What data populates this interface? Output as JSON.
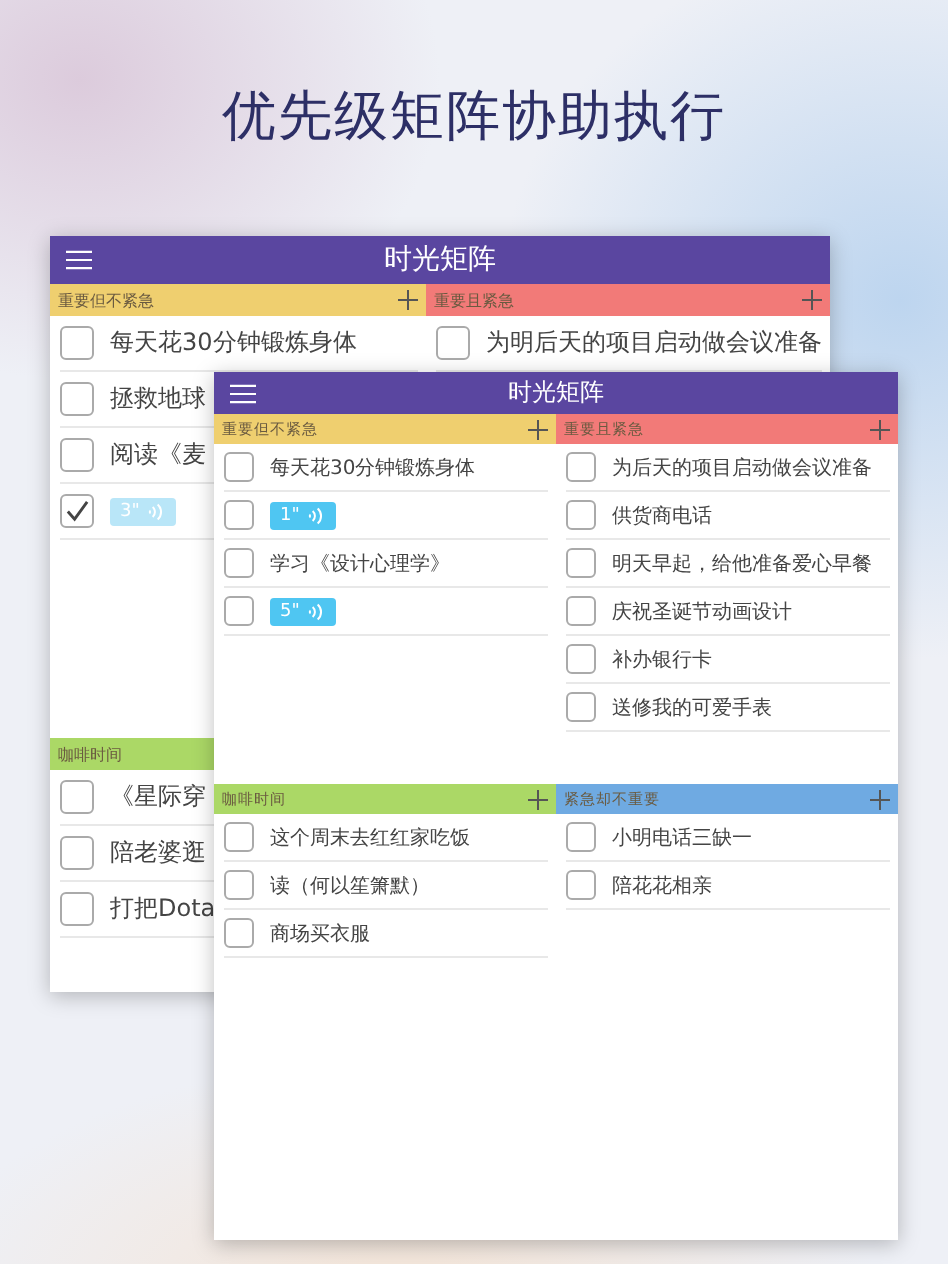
{
  "headline": "优先级矩阵协助执行",
  "screens": [
    {
      "title": "时光矩阵",
      "quadrants": [
        {
          "title": "重要但不紧急",
          "color": "#efcf6f",
          "add_button": true,
          "items": [
            {
              "kind": "text",
              "text": "每天花30分钟锻炼身体",
              "checked": false
            },
            {
              "kind": "text",
              "text": "拯救地球",
              "checked": false
            },
            {
              "kind": "text",
              "text": "阅读《麦",
              "checked": false
            },
            {
              "kind": "voice",
              "text": "3\"",
              "checked": true
            }
          ]
        },
        {
          "title": "重要且紧急",
          "color": "#f27a78",
          "add_button": true,
          "items": [
            {
              "kind": "text",
              "text": "为明后天的项目启动做会议准备",
              "checked": false
            }
          ]
        },
        {
          "title": "咖啡时间",
          "color": "#abd866",
          "items": [
            {
              "kind": "text",
              "text": "《星际穿",
              "checked": false
            },
            {
              "kind": "text",
              "text": "陪老婆逛",
              "checked": false
            },
            {
              "kind": "text",
              "text": "打把Dota",
              "checked": false
            }
          ]
        }
      ]
    },
    {
      "title": "时光矩阵",
      "quadrants": [
        {
          "title": "重要但不紧急",
          "color": "#efcf6f",
          "add_button": true,
          "items": [
            {
              "kind": "text",
              "text": "每天花30分钟锻炼身体",
              "checked": false
            },
            {
              "kind": "voice",
              "text": "1\"",
              "checked": false
            },
            {
              "kind": "text",
              "text": "学习《设计心理学》",
              "checked": false
            },
            {
              "kind": "voice",
              "text": "5\"",
              "checked": false
            }
          ]
        },
        {
          "title": "重要且紧急",
          "color": "#f27a78",
          "add_button": true,
          "items": [
            {
              "kind": "text",
              "text": "为后天的项目启动做会议准备",
              "checked": false
            },
            {
              "kind": "text",
              "text": "供货商电话",
              "checked": false
            },
            {
              "kind": "text",
              "text": "明天早起，给他准备爱心早餐",
              "checked": false
            },
            {
              "kind": "text",
              "text": "庆祝圣诞节动画设计",
              "checked": false
            },
            {
              "kind": "text",
              "text": "补办银行卡",
              "checked": false
            },
            {
              "kind": "text",
              "text": "送修我的可爱手表",
              "checked": false
            }
          ]
        },
        {
          "title": "咖啡时间",
          "color": "#abd866",
          "add_button": true,
          "items": [
            {
              "kind": "text",
              "text": "这个周末去红红家吃饭",
              "checked": false
            },
            {
              "kind": "text",
              "text": "读（何以笙箫默）",
              "checked": false
            },
            {
              "kind": "text",
              "text": "商场买衣服",
              "checked": false
            }
          ]
        },
        {
          "title": "紧急却不重要",
          "color": "#6faae2",
          "add_button": true,
          "items": [
            {
              "kind": "text",
              "text": "小明电话三缺一",
              "checked": false
            },
            {
              "kind": "text",
              "text": "陪花花相亲",
              "checked": false
            }
          ]
        }
      ]
    }
  ]
}
